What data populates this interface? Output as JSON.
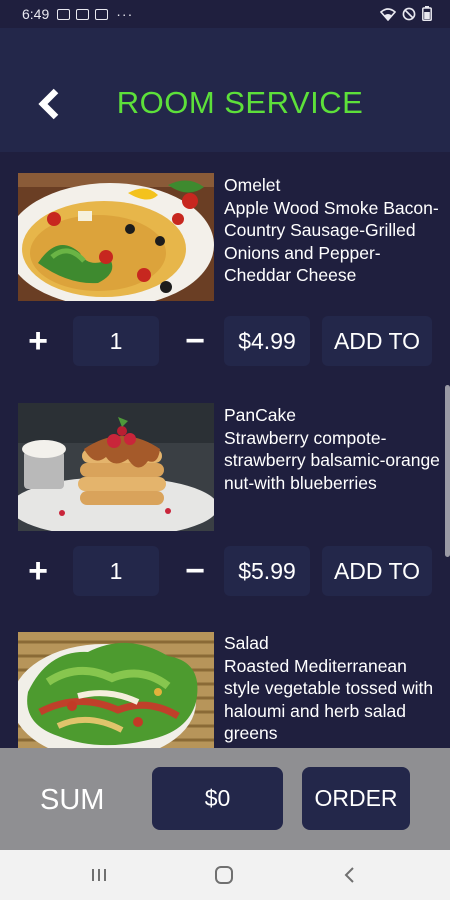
{
  "status_bar": {
    "time": "6:49",
    "more": "···"
  },
  "header": {
    "title": "ROOM SERVICE"
  },
  "items": [
    {
      "name": "Omelet",
      "description": "Apple Wood Smoke Bacon-Country Sausage-Grilled Onions and Pepper-Cheddar Cheese",
      "quantity": "1",
      "price": "$4.99",
      "add_label": "ADD TO"
    },
    {
      "name": "PanCake",
      "description": "Strawberry compote-strawberry balsamic-orange nut-with blueberries",
      "quantity": "1",
      "price": "$5.99",
      "add_label": "ADD TO"
    },
    {
      "name": "Salad",
      "description": "Roasted Mediterranean style vegetable tossed with haloumi and herb salad greens"
    }
  ],
  "controls": {
    "plus": "+",
    "minus": "−"
  },
  "footer": {
    "sum_label": "SUM",
    "sum_value": "$0",
    "order_label": "ORDER"
  },
  "colors": {
    "accent": "#5de03a",
    "background": "#1f1f3e",
    "panel": "#23274a",
    "footer": "#8f8f92"
  }
}
